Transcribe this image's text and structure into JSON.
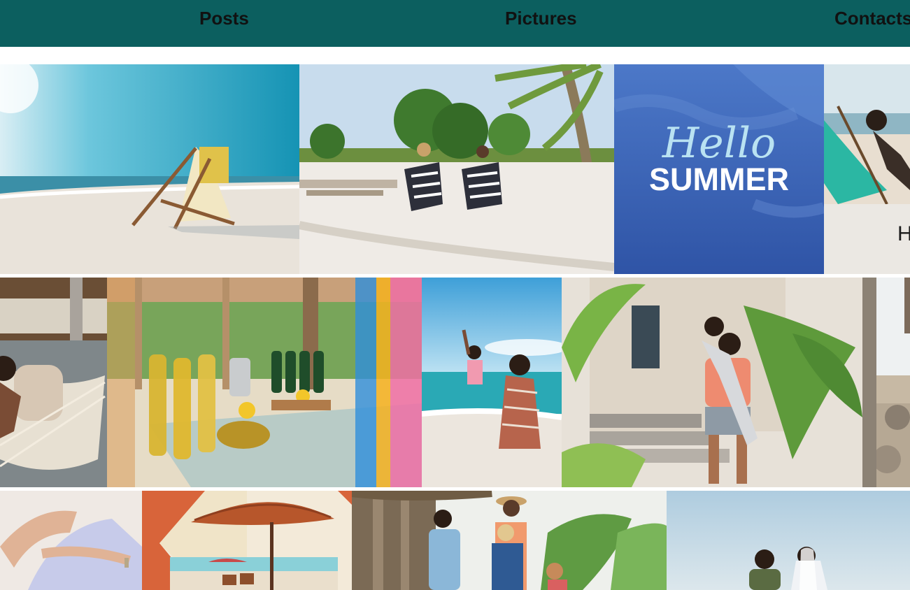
{
  "nav": {
    "items": [
      {
        "label": "Posts"
      },
      {
        "label": "Pictures"
      },
      {
        "label": "Contacts"
      }
    ]
  },
  "gallery": {
    "summer_card": {
      "script_text": "Hello",
      "bold_text": "SUMMER"
    },
    "partial_card_text": "H"
  },
  "colors": {
    "nav_background": "#0c5f5f",
    "nav_text": "#111111",
    "summer_card_bg": "#3f66b8",
    "orange_frame": "#d8643a"
  }
}
